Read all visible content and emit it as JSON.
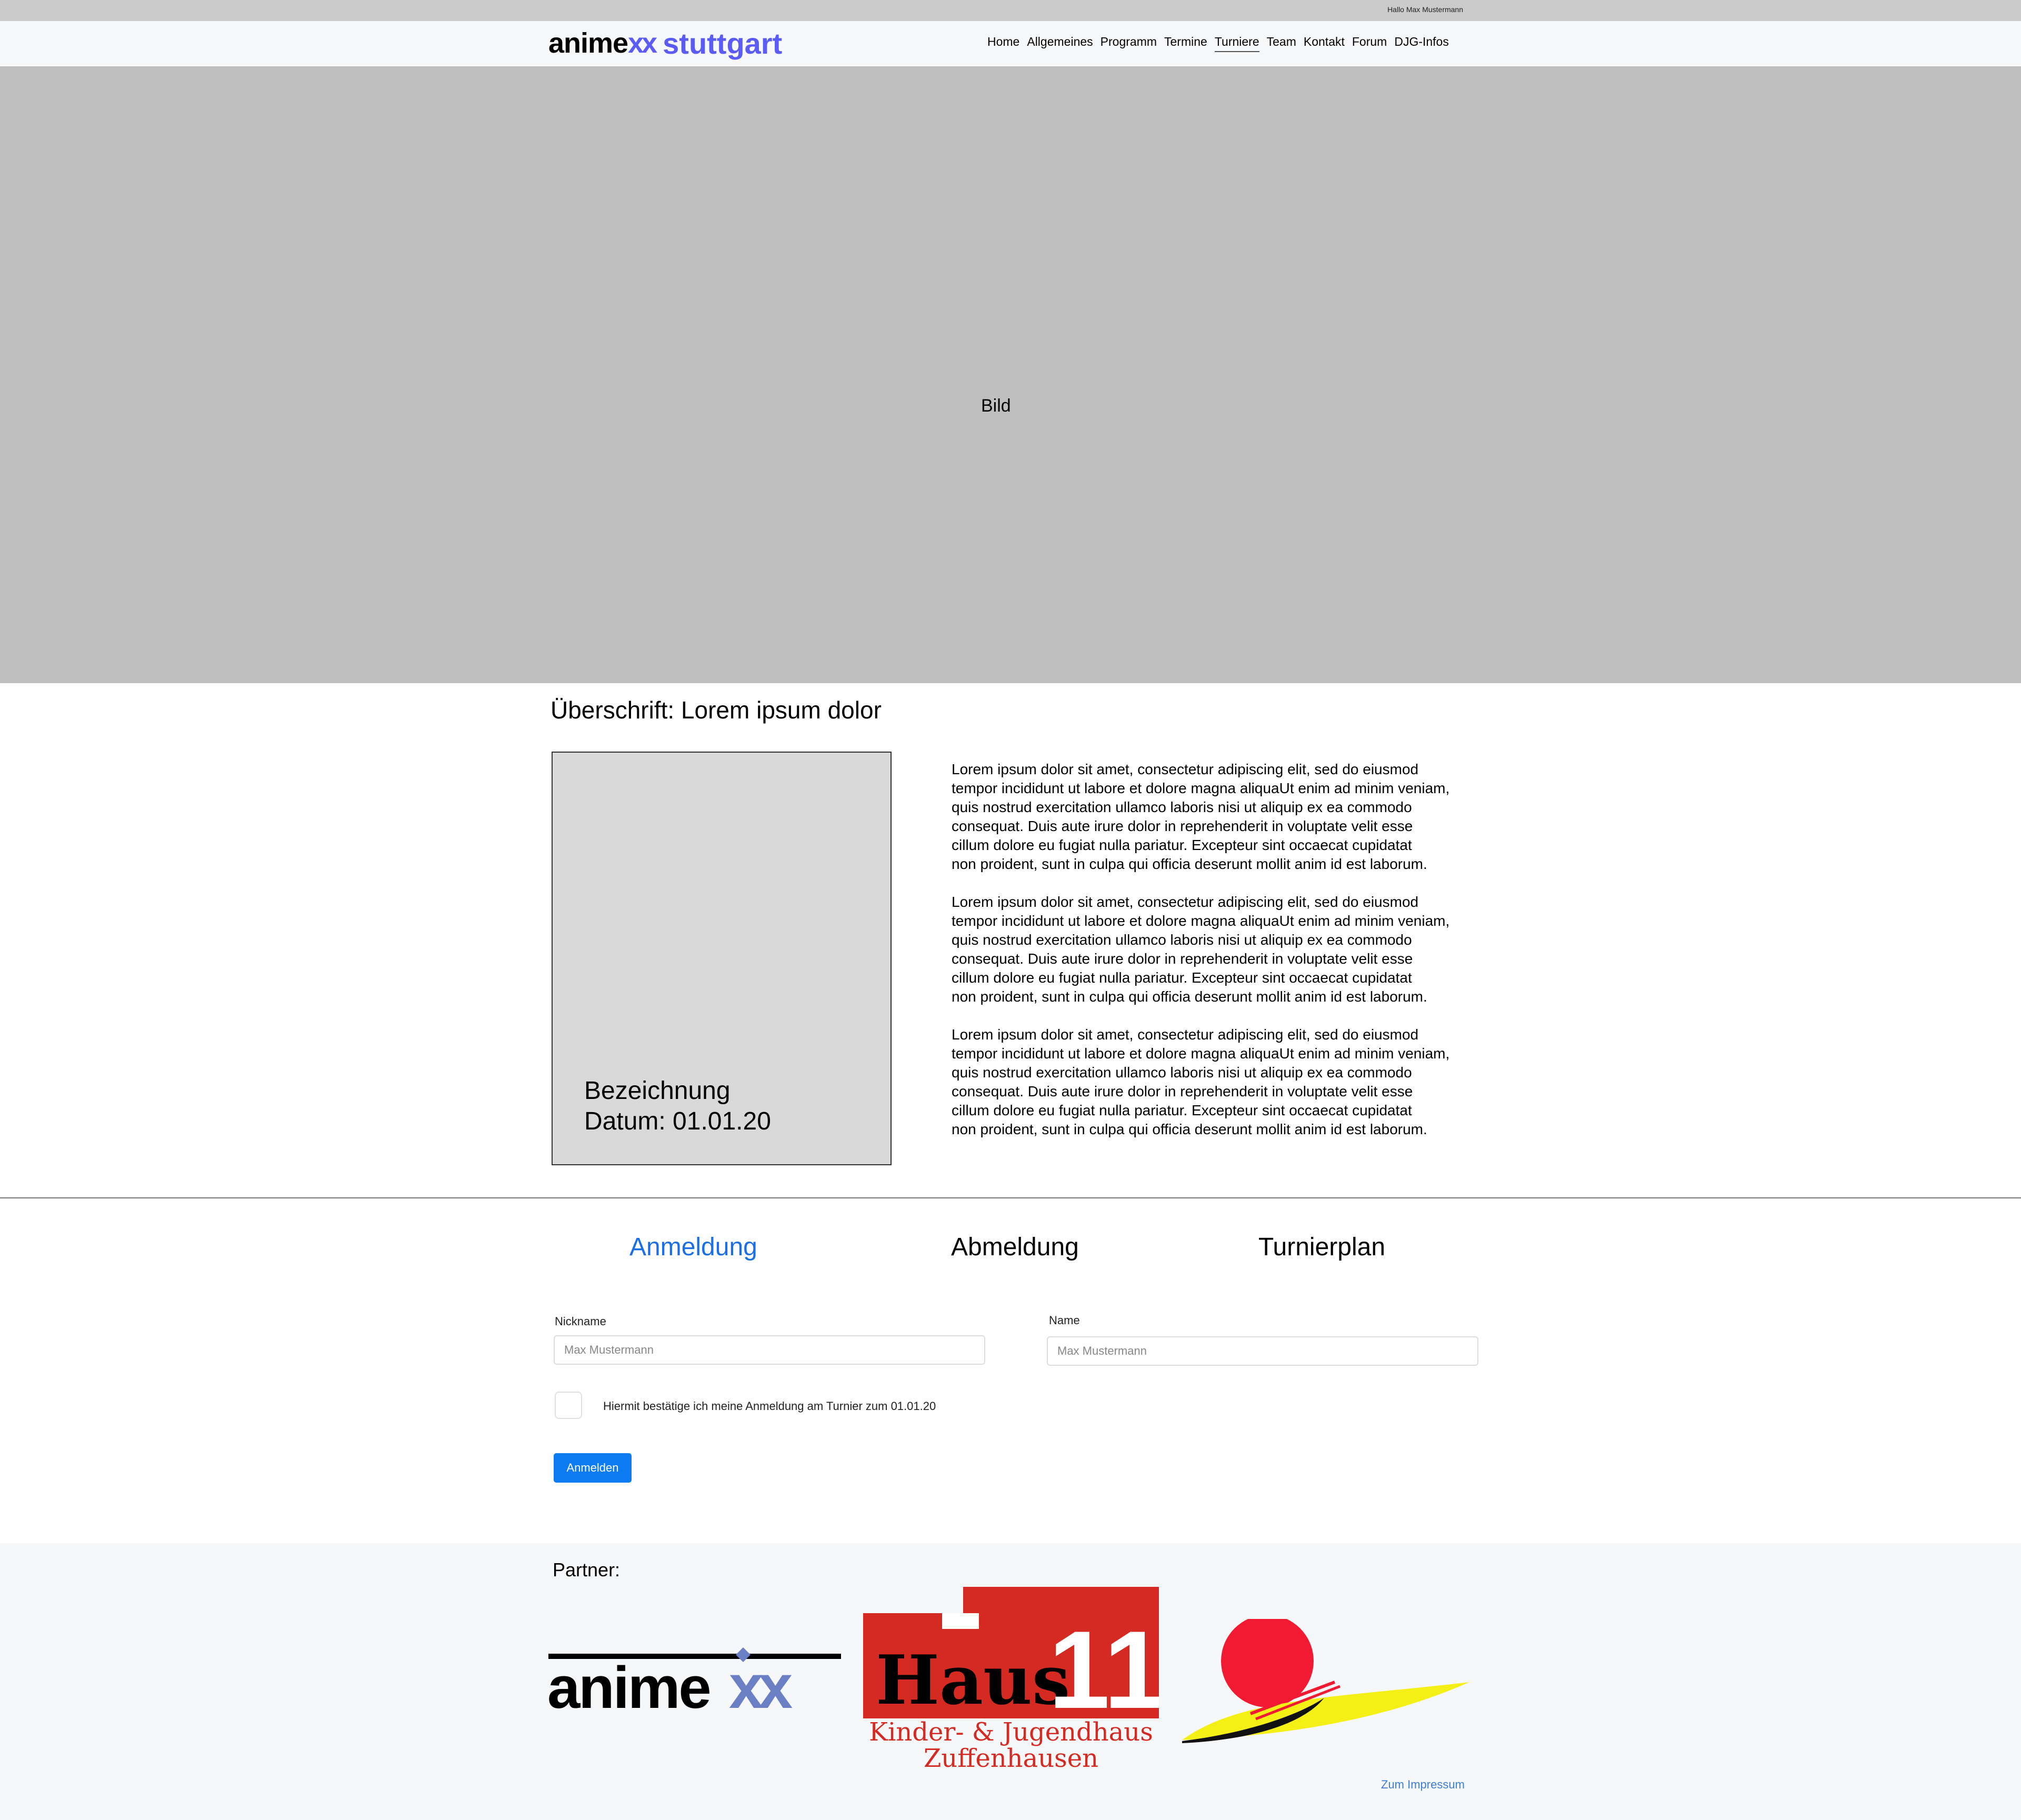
{
  "header": {
    "greeting": "Hallo Max Mustermann",
    "logo": {
      "brand": "anime",
      "brand_suffix": "xx",
      "city": "stuttgart"
    },
    "nav": [
      "Home",
      "Allgemeines",
      "Programm",
      "Termine",
      "Turniere",
      "Team",
      "Kontakt",
      "Forum",
      "DJG-Infos"
    ],
    "active_nav": "Turniere"
  },
  "hero": {
    "label": "Bild"
  },
  "content": {
    "heading": "Überschrift: Lorem ipsum dolor",
    "card": {
      "title": "Bezeichnung",
      "date": "Datum: 01.01.20"
    },
    "paragraphs": [
      "Lorem ipsum dolor sit amet, consectetur adipiscing elit, sed do eiusmod\ntempor incididunt ut labore et dolore magna aliquaUt enim ad minim veniam,\nquis nostrud exercitation ullamco laboris nisi ut aliquip ex ea commodo\nconsequat. Duis aute irure dolor in reprehenderit in voluptate velit esse\ncillum dolore eu fugiat nulla pariatur. Excepteur sint occaecat cupidatat\nnon proident, sunt in culpa qui officia deserunt mollit anim id est laborum.",
      "Lorem ipsum dolor sit amet, consectetur adipiscing elit, sed do eiusmod\ntempor incididunt ut labore et dolore magna aliquaUt enim ad minim veniam,\nquis nostrud exercitation ullamco laboris nisi ut aliquip ex ea commodo\nconsequat. Duis aute irure dolor in reprehenderit in voluptate velit esse\ncillum dolore eu fugiat nulla pariatur. Excepteur sint occaecat cupidatat\nnon proident, sunt in culpa qui officia deserunt mollit anim id est laborum.",
      "Lorem ipsum dolor sit amet, consectetur adipiscing elit, sed do eiusmod\ntempor incididunt ut labore et dolore magna aliquaUt enim ad minim veniam,\nquis nostrud exercitation ullamco laboris nisi ut aliquip ex ea commodo\nconsequat. Duis aute irure dolor in reprehenderit in voluptate velit esse\ncillum dolore eu fugiat nulla pariatur. Excepteur sint occaecat cupidatat\nnon proident, sunt in culpa qui officia deserunt mollit anim id est laborum."
    ]
  },
  "tabs": {
    "items": [
      "Anmeldung",
      "Abmeldung",
      "Turnierplan"
    ],
    "active": "Anmeldung",
    "active_color": "#1a6fe8"
  },
  "form": {
    "nickname_label": "Nickname",
    "nickname_placeholder": "Max Mustermann",
    "name_label": "Name",
    "name_placeholder": "Max Mustermann",
    "confirm_label": "Hiermit bestätige ich meine Anmeldung am Turnier zum 01.01.20",
    "confirm_checked": false,
    "submit_label": "Anmelden",
    "submit_color": "#0d7bf2"
  },
  "footer": {
    "partner_title": "Partner:",
    "partners": [
      {
        "name": "animexx",
        "logo_text": "animexx"
      },
      {
        "name": "haus11",
        "logo_text": "Haus 11",
        "subtitle_line1": "Kinder- & Jugendhaus",
        "subtitle_line2": "Zuffenhausen"
      },
      {
        "name": "sun-logo",
        "icon": "sun-wave-logo"
      }
    ],
    "impressum_label": "Zum Impressum",
    "link_color": "#3b7dd8"
  }
}
